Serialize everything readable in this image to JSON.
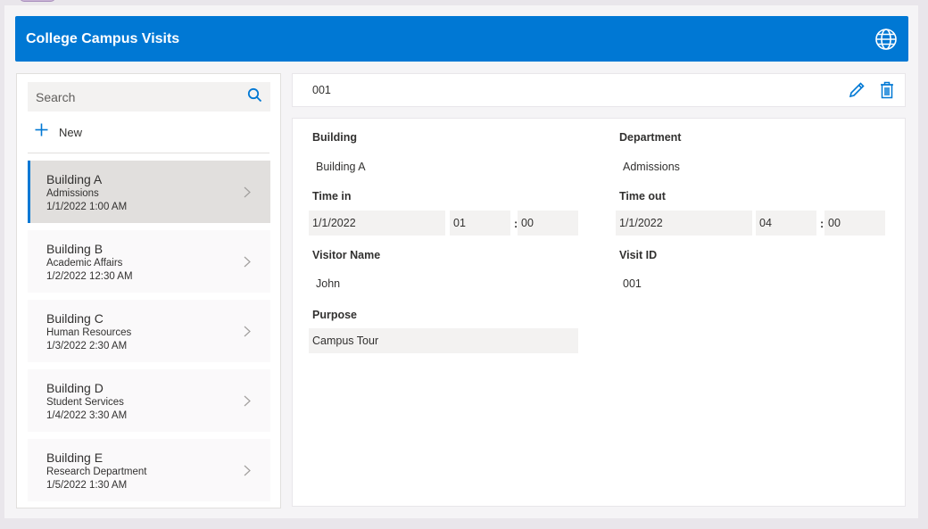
{
  "app": {
    "title": "College Campus Visits"
  },
  "search": {
    "placeholder": "Search"
  },
  "new_button": {
    "label": "New"
  },
  "visits": [
    {
      "building": "Building A",
      "department": "Admissions",
      "datetime": "1/1/2022 1:00 AM"
    },
    {
      "building": "Building B",
      "department": "Academic Affairs",
      "datetime": "1/2/2022 12:30 AM"
    },
    {
      "building": "Building C",
      "department": "Human Resources",
      "datetime": "1/3/2022 2:30 AM"
    },
    {
      "building": "Building D",
      "department": "Student Services",
      "datetime": "1/4/2022 3:30 AM"
    },
    {
      "building": "Building E",
      "department": "Research Department",
      "datetime": "1/5/2022 1:30 AM"
    }
  ],
  "detail": {
    "id": "001",
    "labels": {
      "building": "Building",
      "department": "Department",
      "time_in": "Time in",
      "time_out": "Time out",
      "visitor_name": "Visitor Name",
      "visit_id": "Visit ID",
      "purpose": "Purpose"
    },
    "values": {
      "building": "Building A",
      "department": "Admissions",
      "time_in_date": "1/1/2022",
      "time_in_hour": "01",
      "time_in_minute": "00",
      "time_out_date": "1/1/2022",
      "time_out_hour": "04",
      "time_out_minute": "00",
      "visitor_name": "John",
      "visit_id": "001",
      "purpose": "Campus Tour"
    },
    "colon": ":"
  },
  "colors": {
    "accent": "#0078d4",
    "selected_bg": "#e1dfdd"
  },
  "icons": {
    "globe": "globe-icon",
    "search": "search-icon",
    "add": "plus-icon",
    "edit": "pencil-icon",
    "delete": "trash-icon",
    "chevron": "chevron-right-icon"
  }
}
